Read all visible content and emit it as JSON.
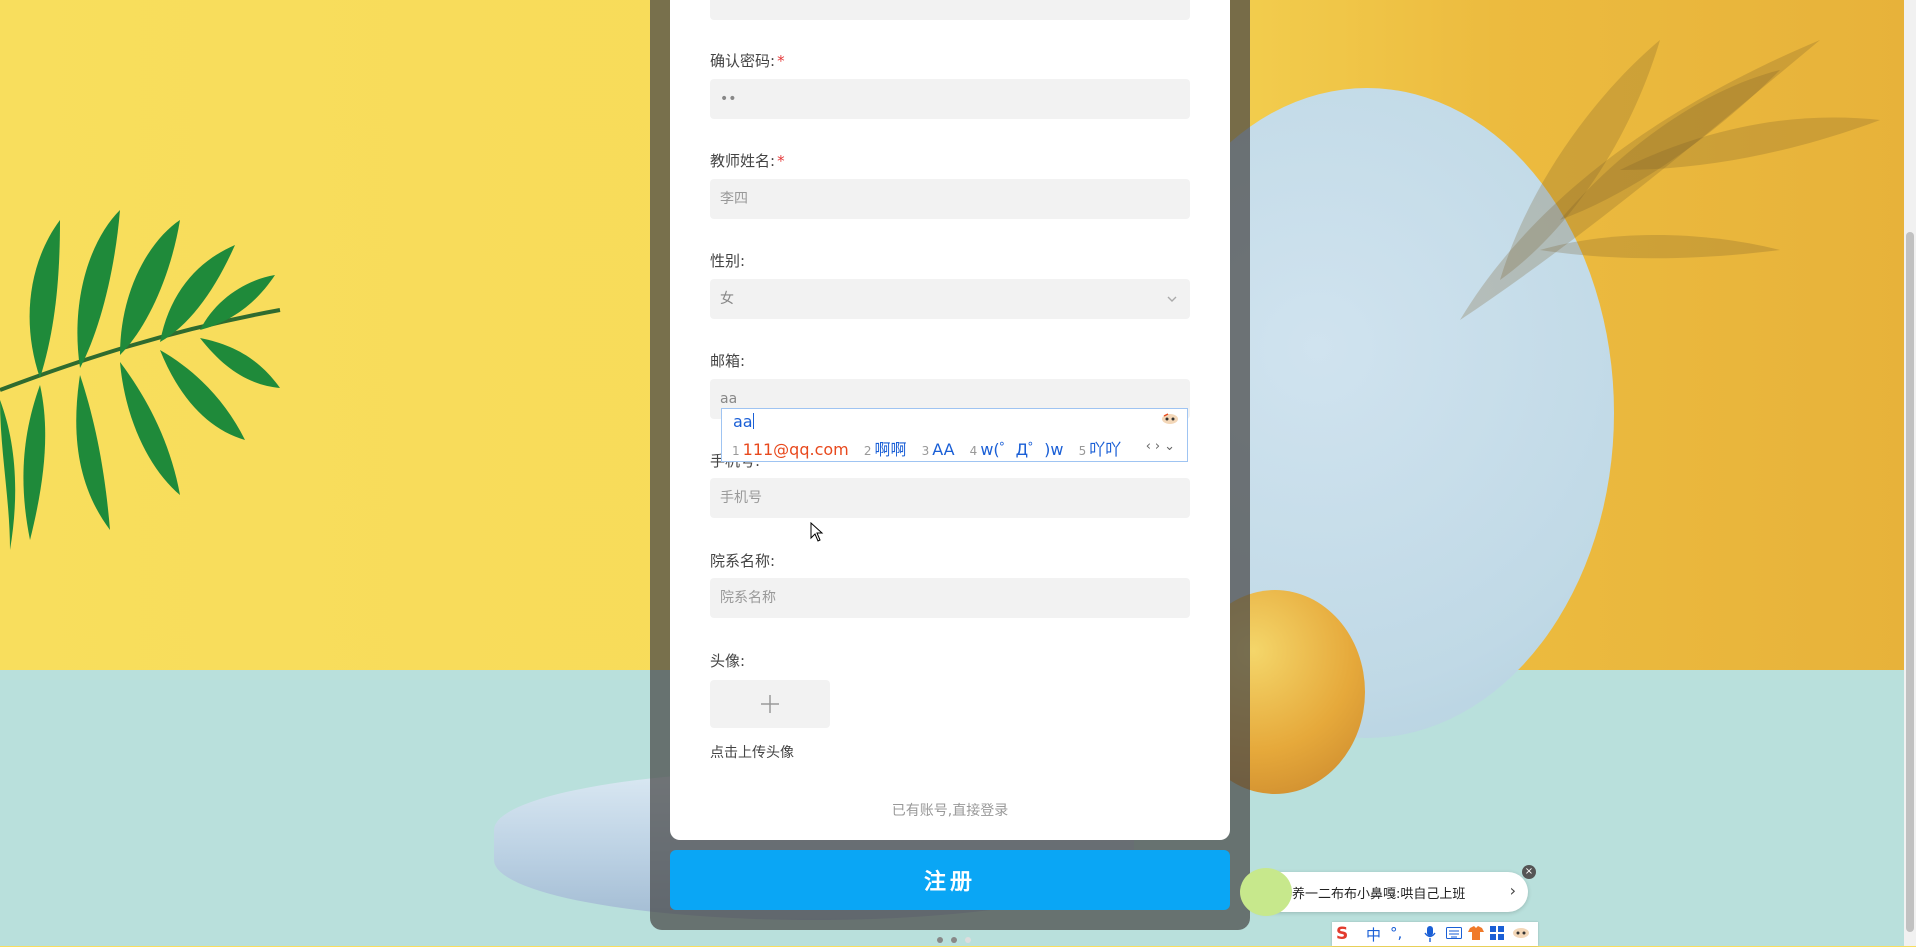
{
  "form": {
    "confirm_password": {
      "label": "确认密码:",
      "required_mark": "*",
      "value": "••"
    },
    "teacher_name": {
      "label": "教师姓名:",
      "required_mark": "*",
      "placeholder": "李四"
    },
    "gender": {
      "label": "性别:",
      "value": "女"
    },
    "email": {
      "label": "邮箱:",
      "value": "aa"
    },
    "phone": {
      "label": "手机号:",
      "placeholder": "手机号"
    },
    "department": {
      "label": "院系名称:",
      "placeholder": "院系名称"
    },
    "avatar": {
      "label": "头像:",
      "hint": "点击上传头像"
    },
    "login_link": "已有账号,直接登录",
    "register_button": "注册"
  },
  "ime_popup": {
    "composition": "aa",
    "candidates": [
      {
        "num": "1",
        "text": "111@qq.com"
      },
      {
        "num": "2",
        "text": "啊啊"
      },
      {
        "num": "3",
        "text": "AA"
      },
      {
        "num": "4",
        "text": "w(゜Д゜)w"
      },
      {
        "num": "5",
        "text": "吖吖"
      }
    ]
  },
  "toast": {
    "text": "养一二布布小鼻嘎:哄自己上班"
  },
  "ime_bar": {
    "logo": "S",
    "mode": "中",
    "punctuation": "°,"
  },
  "colors": {
    "primary_button": "#0aa6f5",
    "required": "#e5393a",
    "ime_blue": "#1a5fd6",
    "ime_first": "#e8491d"
  }
}
